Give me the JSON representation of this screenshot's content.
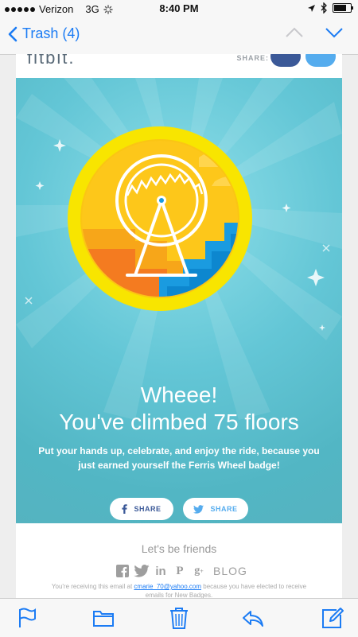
{
  "status_bar": {
    "carrier": "Verizon",
    "network": "3G",
    "time": "8:40 PM",
    "battery_level": 0.85
  },
  "nav": {
    "back_label": "Trash (4)",
    "up_icon": "chevron-up-icon",
    "down_icon": "chevron-down-icon"
  },
  "email": {
    "logo_text": "fitbit.",
    "share_label": "SHARE:",
    "headline_line1": "Wheee!",
    "headline_line2": "You've climbed 75 floors",
    "subtext": "Put your hands up, celebrate, and enjoy the ride, because you just earned yourself the Ferris Wheel badge!",
    "share_buttons": [
      {
        "label": "SHARE",
        "icon": "facebook-icon"
      },
      {
        "label": "SHARE",
        "icon": "twitter-icon"
      }
    ],
    "footer": {
      "friends": "Let's be friends",
      "social_icons": [
        "facebook-icon",
        "twitter-icon",
        "linkedin-icon",
        "pinterest-icon",
        "googleplus-icon"
      ],
      "blog": "BLOG",
      "legal_prefix": "You're receiving this email at ",
      "legal_email": "cmarie_70@yahoo.com",
      "legal_suffix": " because you have elected to receive emails for New Badges."
    }
  },
  "toolbar": {
    "icons": [
      "flag-icon",
      "folder-icon",
      "trash-icon",
      "reply-icon",
      "compose-icon"
    ]
  },
  "colors": {
    "ios_blue": "#1c7cf4",
    "hero_teal": "#63c6d6",
    "badge_yellow": "#f6de00",
    "facebook": "#3b5998",
    "twitter": "#55acee"
  }
}
